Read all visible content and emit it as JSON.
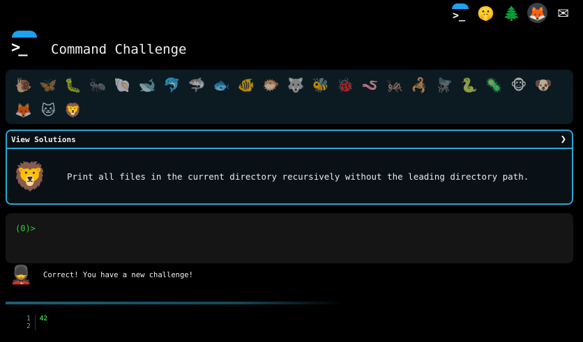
{
  "nav": [
    {
      "name": "logo-nav-icon",
      "kind": "logo"
    },
    {
      "name": "shush-face-icon",
      "glyph": "🤫"
    },
    {
      "name": "tree-icon",
      "glyph": "🌲"
    },
    {
      "name": "gitlab-icon",
      "glyph": "🦊"
    },
    {
      "name": "mail-icon",
      "glyph": "✉"
    }
  ],
  "header": {
    "title": "Command Challenge",
    "prompt_glyph": ">_"
  },
  "animals": [
    {
      "name": "snail-icon",
      "glyph": "🐌",
      "done": true
    },
    {
      "name": "butterfly-icon",
      "glyph": "🦋",
      "done": true
    },
    {
      "name": "caterpillar-icon",
      "glyph": "🐛",
      "done": true
    },
    {
      "name": "ant-icon",
      "glyph": "🐜",
      "done": true
    },
    {
      "name": "shell-icon",
      "glyph": "🐚",
      "done": true
    },
    {
      "name": "whale-icon",
      "glyph": "🐋",
      "done": true
    },
    {
      "name": "dolphin-icon",
      "glyph": "🐬",
      "done": true
    },
    {
      "name": "shark-icon",
      "glyph": "🦈",
      "done": true
    },
    {
      "name": "fish-icon",
      "glyph": "🐟",
      "done": true
    },
    {
      "name": "tropical-fish-icon",
      "glyph": "🐠",
      "done": true
    },
    {
      "name": "blowfish-icon",
      "glyph": "🐡",
      "done": true
    },
    {
      "name": "wolf-icon",
      "glyph": "🐺",
      "done": true
    },
    {
      "name": "bee-icon",
      "glyph": "🐝",
      "done": true
    },
    {
      "name": "ladybug-icon",
      "glyph": "🐞",
      "done": true
    },
    {
      "name": "worm-icon",
      "glyph": "🪱",
      "done": true
    },
    {
      "name": "cricket-icon",
      "glyph": "🦗",
      "done": true
    },
    {
      "name": "scorpion-icon",
      "glyph": "🦂",
      "done": true
    },
    {
      "name": "fly-icon",
      "glyph": "🪰",
      "done": true
    },
    {
      "name": "snake-icon",
      "glyph": "🐍",
      "done": true
    },
    {
      "name": "microbe-icon",
      "glyph": "🦠",
      "done": true
    },
    {
      "name": "monkey-icon",
      "glyph": "🐵",
      "done": true
    },
    {
      "name": "dog-icon",
      "glyph": "🐶",
      "done": true
    },
    {
      "name": "fox-icon",
      "glyph": "🦊",
      "done": true
    },
    {
      "name": "cat-icon",
      "glyph": "🐱",
      "done": true
    },
    {
      "name": "lion-icon",
      "glyph": "🦁",
      "done": false
    }
  ],
  "challenge": {
    "view_solutions_label": "View Solutions",
    "chevron": "❯",
    "face_glyph": "🦁",
    "text": "Print all files in the current directory recursively without the leading directory path."
  },
  "terminal": {
    "prompt": "(0)>"
  },
  "feedback": {
    "guard_glyph": "💂",
    "message": "Correct! You have a new challenge!"
  },
  "output": {
    "line_numbers": [
      "1",
      "2"
    ],
    "lines": [
      "42",
      ""
    ]
  }
}
